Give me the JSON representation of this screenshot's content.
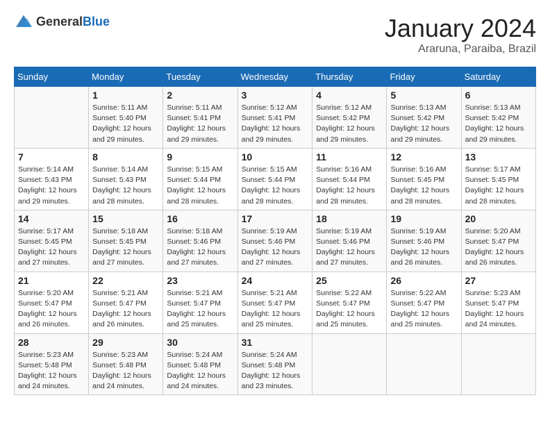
{
  "header": {
    "logo_general": "General",
    "logo_blue": "Blue",
    "month_year": "January 2024",
    "location": "Araruna, Paraiba, Brazil"
  },
  "days_of_week": [
    "Sunday",
    "Monday",
    "Tuesday",
    "Wednesday",
    "Thursday",
    "Friday",
    "Saturday"
  ],
  "weeks": [
    [
      {
        "day": "",
        "sunrise": "",
        "sunset": "",
        "daylight": ""
      },
      {
        "day": "1",
        "sunrise": "5:11 AM",
        "sunset": "5:40 PM",
        "daylight": "12 hours and 29 minutes."
      },
      {
        "day": "2",
        "sunrise": "5:11 AM",
        "sunset": "5:41 PM",
        "daylight": "12 hours and 29 minutes."
      },
      {
        "day": "3",
        "sunrise": "5:12 AM",
        "sunset": "5:41 PM",
        "daylight": "12 hours and 29 minutes."
      },
      {
        "day": "4",
        "sunrise": "5:12 AM",
        "sunset": "5:42 PM",
        "daylight": "12 hours and 29 minutes."
      },
      {
        "day": "5",
        "sunrise": "5:13 AM",
        "sunset": "5:42 PM",
        "daylight": "12 hours and 29 minutes."
      },
      {
        "day": "6",
        "sunrise": "5:13 AM",
        "sunset": "5:42 PM",
        "daylight": "12 hours and 29 minutes."
      }
    ],
    [
      {
        "day": "7",
        "sunrise": "5:14 AM",
        "sunset": "5:43 PM",
        "daylight": "12 hours and 29 minutes."
      },
      {
        "day": "8",
        "sunrise": "5:14 AM",
        "sunset": "5:43 PM",
        "daylight": "12 hours and 28 minutes."
      },
      {
        "day": "9",
        "sunrise": "5:15 AM",
        "sunset": "5:44 PM",
        "daylight": "12 hours and 28 minutes."
      },
      {
        "day": "10",
        "sunrise": "5:15 AM",
        "sunset": "5:44 PM",
        "daylight": "12 hours and 28 minutes."
      },
      {
        "day": "11",
        "sunrise": "5:16 AM",
        "sunset": "5:44 PM",
        "daylight": "12 hours and 28 minutes."
      },
      {
        "day": "12",
        "sunrise": "5:16 AM",
        "sunset": "5:45 PM",
        "daylight": "12 hours and 28 minutes."
      },
      {
        "day": "13",
        "sunrise": "5:17 AM",
        "sunset": "5:45 PM",
        "daylight": "12 hours and 28 minutes."
      }
    ],
    [
      {
        "day": "14",
        "sunrise": "5:17 AM",
        "sunset": "5:45 PM",
        "daylight": "12 hours and 27 minutes."
      },
      {
        "day": "15",
        "sunrise": "5:18 AM",
        "sunset": "5:45 PM",
        "daylight": "12 hours and 27 minutes."
      },
      {
        "day": "16",
        "sunrise": "5:18 AM",
        "sunset": "5:46 PM",
        "daylight": "12 hours and 27 minutes."
      },
      {
        "day": "17",
        "sunrise": "5:19 AM",
        "sunset": "5:46 PM",
        "daylight": "12 hours and 27 minutes."
      },
      {
        "day": "18",
        "sunrise": "5:19 AM",
        "sunset": "5:46 PM",
        "daylight": "12 hours and 27 minutes."
      },
      {
        "day": "19",
        "sunrise": "5:19 AM",
        "sunset": "5:46 PM",
        "daylight": "12 hours and 26 minutes."
      },
      {
        "day": "20",
        "sunrise": "5:20 AM",
        "sunset": "5:47 PM",
        "daylight": "12 hours and 26 minutes."
      }
    ],
    [
      {
        "day": "21",
        "sunrise": "5:20 AM",
        "sunset": "5:47 PM",
        "daylight": "12 hours and 26 minutes."
      },
      {
        "day": "22",
        "sunrise": "5:21 AM",
        "sunset": "5:47 PM",
        "daylight": "12 hours and 26 minutes."
      },
      {
        "day": "23",
        "sunrise": "5:21 AM",
        "sunset": "5:47 PM",
        "daylight": "12 hours and 25 minutes."
      },
      {
        "day": "24",
        "sunrise": "5:21 AM",
        "sunset": "5:47 PM",
        "daylight": "12 hours and 25 minutes."
      },
      {
        "day": "25",
        "sunrise": "5:22 AM",
        "sunset": "5:47 PM",
        "daylight": "12 hours and 25 minutes."
      },
      {
        "day": "26",
        "sunrise": "5:22 AM",
        "sunset": "5:47 PM",
        "daylight": "12 hours and 25 minutes."
      },
      {
        "day": "27",
        "sunrise": "5:23 AM",
        "sunset": "5:47 PM",
        "daylight": "12 hours and 24 minutes."
      }
    ],
    [
      {
        "day": "28",
        "sunrise": "5:23 AM",
        "sunset": "5:48 PM",
        "daylight": "12 hours and 24 minutes."
      },
      {
        "day": "29",
        "sunrise": "5:23 AM",
        "sunset": "5:48 PM",
        "daylight": "12 hours and 24 minutes."
      },
      {
        "day": "30",
        "sunrise": "5:24 AM",
        "sunset": "5:48 PM",
        "daylight": "12 hours and 24 minutes."
      },
      {
        "day": "31",
        "sunrise": "5:24 AM",
        "sunset": "5:48 PM",
        "daylight": "12 hours and 23 minutes."
      },
      {
        "day": "",
        "sunrise": "",
        "sunset": "",
        "daylight": ""
      },
      {
        "day": "",
        "sunrise": "",
        "sunset": "",
        "daylight": ""
      },
      {
        "day": "",
        "sunrise": "",
        "sunset": "",
        "daylight": ""
      }
    ]
  ]
}
